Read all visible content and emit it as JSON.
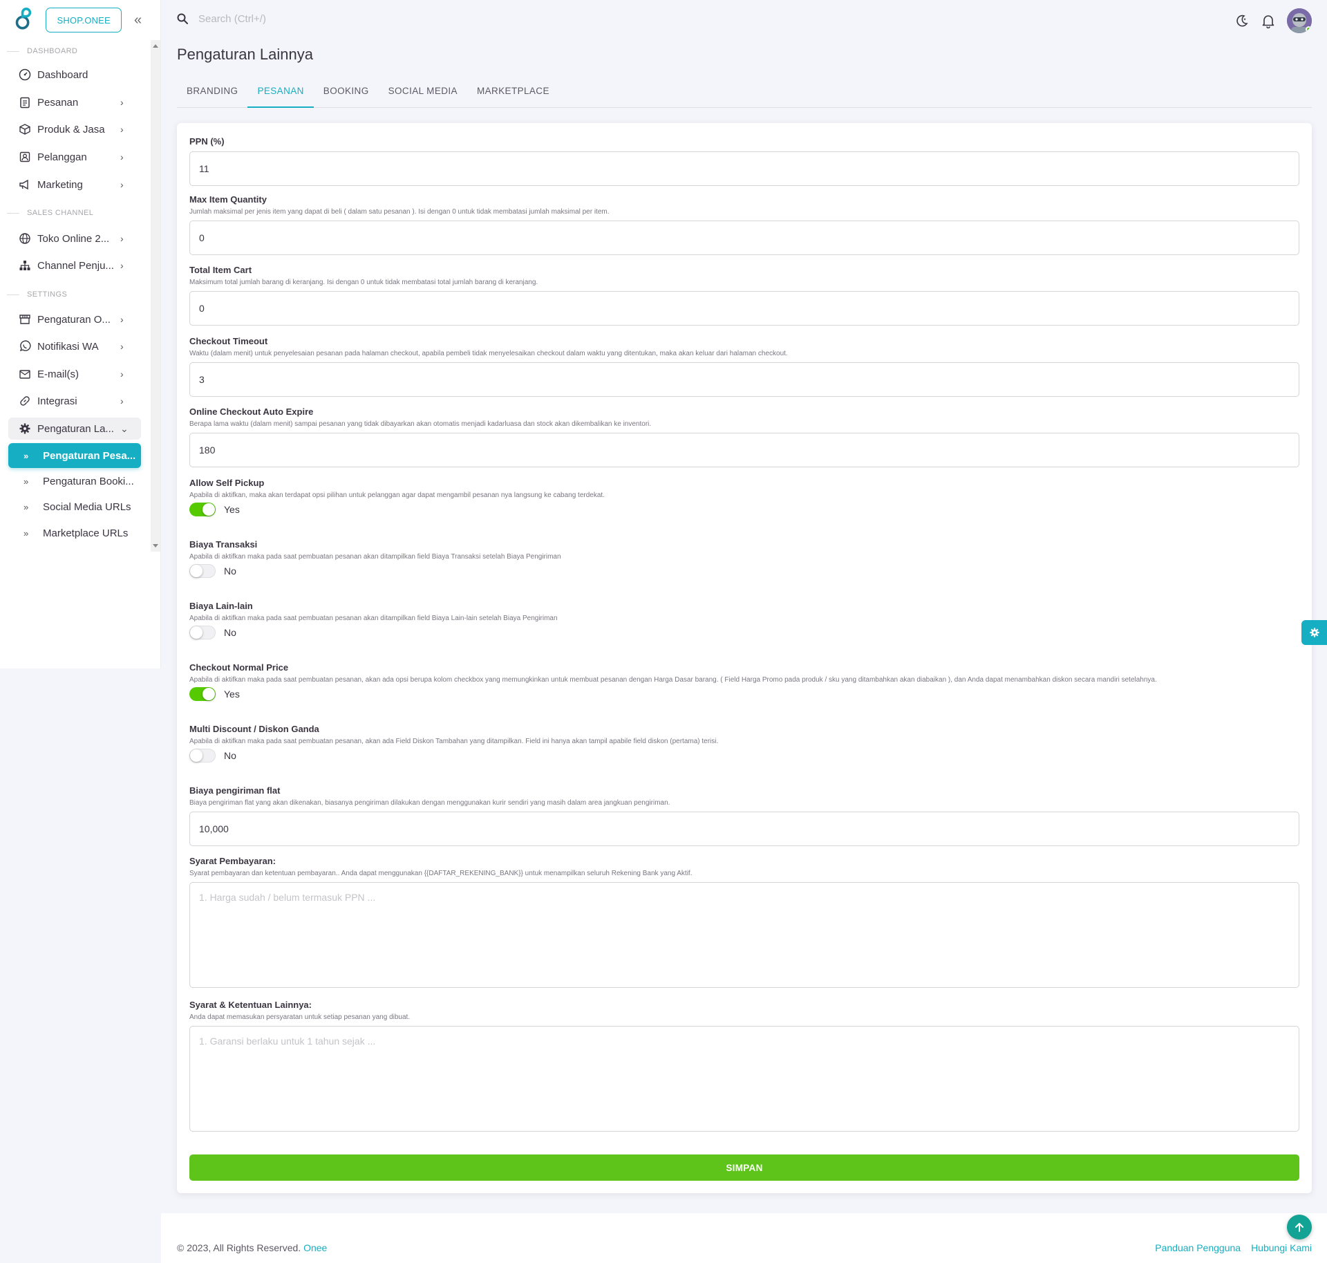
{
  "brand": {
    "shop_label": "SHOP.ONEE"
  },
  "search": {
    "placeholder": "Search (Ctrl+/)"
  },
  "sidebar": {
    "sections": [
      "DASHBOARD",
      "SALES CHANNEL",
      "SETTINGS"
    ],
    "items": [
      {
        "label": "Dashboard",
        "icon": "dashboard-icon"
      },
      {
        "label": "Pesanan",
        "icon": "clipboard-icon"
      },
      {
        "label": "Produk & Jasa",
        "icon": "box-icon"
      },
      {
        "label": "Pelanggan",
        "icon": "contact-icon"
      },
      {
        "label": "Marketing",
        "icon": "megaphone-icon"
      },
      {
        "label": "Toko Online 2...",
        "icon": "globe-icon"
      },
      {
        "label": "Channel Penju...",
        "icon": "sitemap-icon"
      },
      {
        "label": "Pengaturan O...",
        "icon": "store-icon"
      },
      {
        "label": "Notifikasi WA",
        "icon": "whatsapp-icon"
      },
      {
        "label": "E-mail(s)",
        "icon": "mail-icon"
      },
      {
        "label": "Integrasi",
        "icon": "link-icon"
      },
      {
        "label": "Pengaturan La...",
        "icon": "gear-icon"
      }
    ],
    "sub_items": [
      "Pengaturan Pesa...",
      "Pengaturan Booki...",
      "Social Media URLs",
      "Marketplace URLs"
    ]
  },
  "page": {
    "title": "Pengaturan Lainnya"
  },
  "tabs": [
    "BRANDING",
    "PESANAN",
    "BOOKING",
    "SOCIAL MEDIA",
    "MARKETPLACE"
  ],
  "form": {
    "ppn": {
      "label": "PPN (%)",
      "value": "11"
    },
    "max_item": {
      "label": "Max Item Quantity",
      "help": "Jumlah maksimal per jenis item yang dapat di beli ( dalam satu pesanan ). Isi dengan 0 untuk tidak membatasi jumlah maksimal per item.",
      "value": "0"
    },
    "total_cart": {
      "label": "Total Item Cart",
      "help": "Maksimum total jumlah barang di keranjang. Isi dengan 0 untuk tidak membatasi total jumlah barang di keranjang.",
      "value": "0"
    },
    "checkout_timeout": {
      "label": "Checkout Timeout",
      "help": "Waktu (dalam menit) untuk penyelesaian pesanan pada halaman checkout, apabila pembeli tidak menyelesaikan checkout dalam waktu yang ditentukan, maka akan keluar dari halaman checkout.",
      "value": "3"
    },
    "auto_expire": {
      "label": "Online Checkout Auto Expire",
      "help": "Berapa lama waktu (dalam menit) sampai pesanan yang tidak dibayarkan akan otomatis menjadi kadarluasa dan stock akan dikembalikan ke inventori.",
      "value": "180"
    },
    "self_pickup": {
      "label": "Allow Self Pickup",
      "help": "Apabila di aktifkan, maka akan terdapat opsi pilihan untuk pelanggan agar dapat mengambil pesanan nya langsung ke cabang terdekat.",
      "state": "Yes"
    },
    "biaya_transaksi": {
      "label": "Biaya Transaksi",
      "help": "Apabila di aktifkan maka pada saat pembuatan pesanan akan ditampilkan field Biaya Transaksi setelah Biaya Pengiriman",
      "state": "No"
    },
    "biaya_lain": {
      "label": "Biaya Lain-lain",
      "help": "Apabila di aktifkan maka pada saat pembuatan pesanan akan ditampilkan field Biaya Lain-lain setelah Biaya Pengiriman",
      "state": "No"
    },
    "normal_price": {
      "label": "Checkout Normal Price",
      "help": "Apabila di aktifkan maka pada saat pembuatan pesanan, akan ada opsi berupa kolom checkbox yang memungkinkan untuk membuat pesanan dengan Harga Dasar barang. ( Field Harga Promo pada produk / sku yang ditambahkan akan diabaikan ), dan Anda dapat menambahkan diskon secara mandiri setelahnya.",
      "state": "Yes"
    },
    "multi_discount": {
      "label": "Multi Discount / Diskon Ganda",
      "help": "Apabila di aktifkan maka pada saat pembuatan pesanan, akan ada Field Diskon Tambahan yang ditampilkan. Field ini hanya akan tampil apabile field diskon (pertama) terisi.",
      "state": "No"
    },
    "flat_shipping": {
      "label": "Biaya pengiriman flat",
      "help": "Biaya pengiriman flat yang akan dikenakan, biasanya pengiriman dilakukan dengan menggunakan kurir sendiri yang masih dalam area jangkuan pengiriman.",
      "value": "10,000"
    },
    "payment_terms": {
      "label": "Syarat Pembayaran:",
      "help": "Syarat pembayaran dan ketentuan pembayaran.. Anda dapat menggunakan {{DAFTAR_REKENING_BANK}} untuk menampilkan seluruh Rekening Bank yang Aktif.",
      "placeholder": "1. Harga sudah / belum termasuk PPN ..."
    },
    "other_terms": {
      "label": "Syarat & Ketentuan Lainnya:",
      "help": "Anda dapat memasukan persyaratan untuk setiap pesanan yang dibuat.",
      "placeholder": "1. Garansi berlaku untuk 1 tahun sejak ..."
    },
    "save_label": "SIMPAN"
  },
  "footer": {
    "copyright": "© 2023, All Rights Reserved. ",
    "brand_link": "Onee",
    "links": [
      "Panduan Pengguna",
      "Hubungi Kami"
    ]
  },
  "colors": {
    "accent": "#16aec2",
    "success": "#56ca00",
    "save": "#5ec41a"
  }
}
